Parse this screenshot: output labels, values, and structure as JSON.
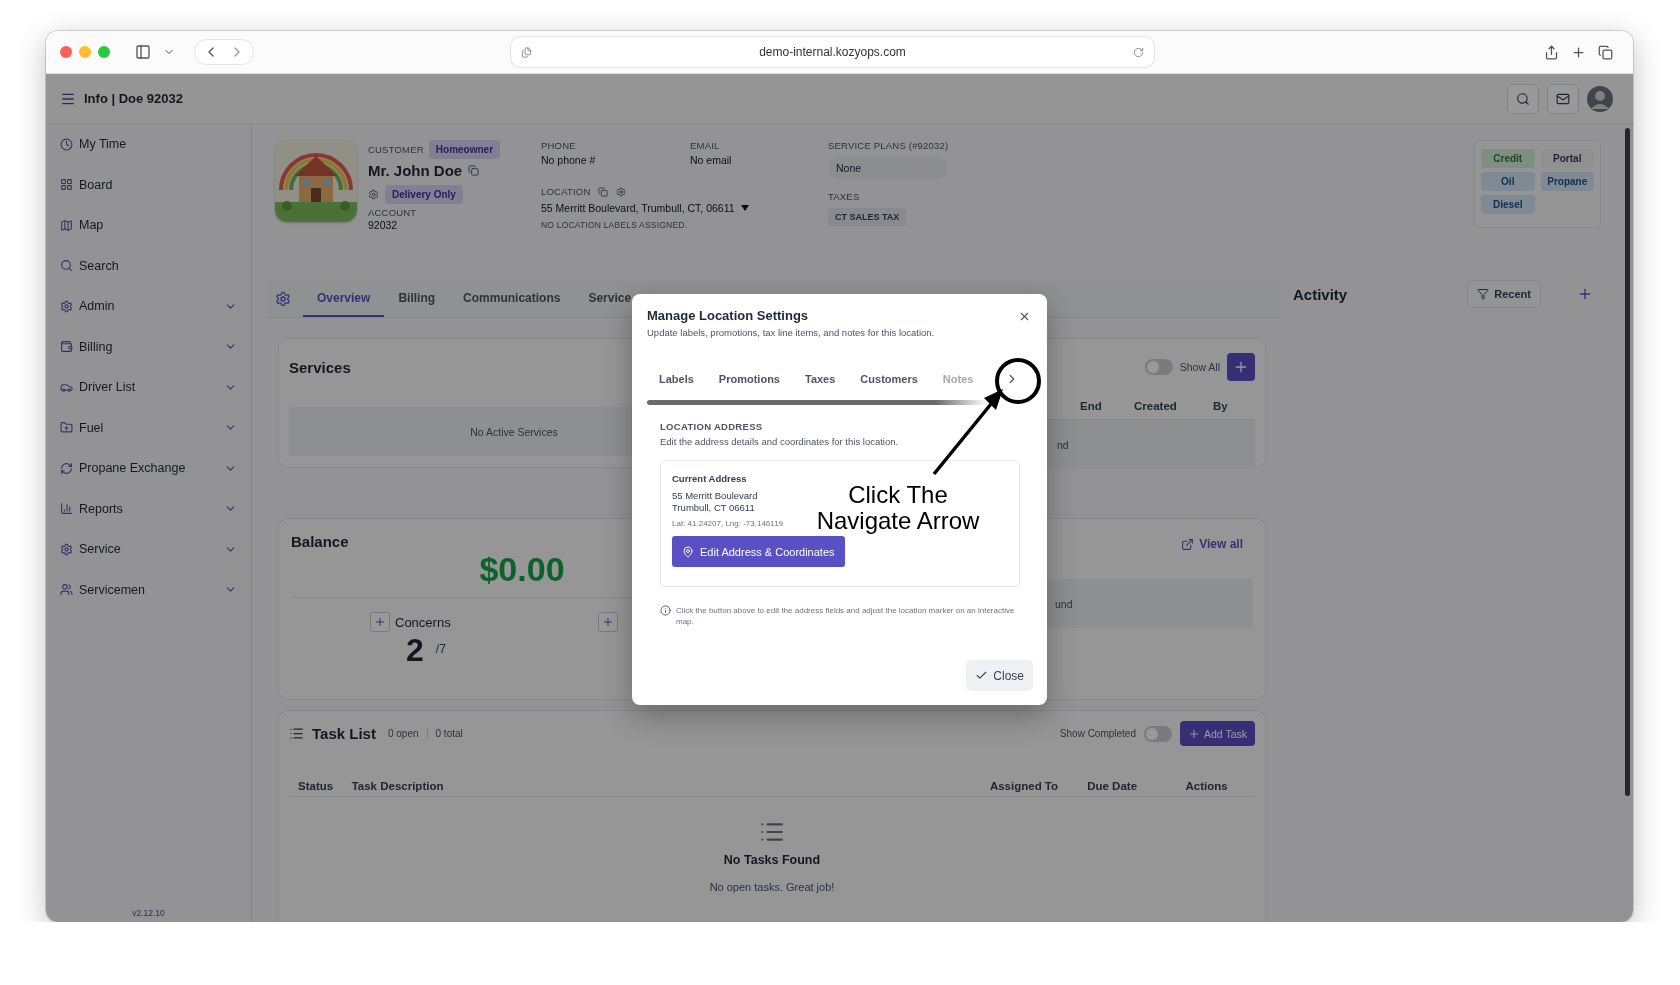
{
  "browser": {
    "url": "demo-internal.kozyops.com"
  },
  "header": {
    "title": "Info | Doe 92032"
  },
  "sidebar": {
    "items": [
      {
        "label": "My Time",
        "expandable": false
      },
      {
        "label": "Board",
        "expandable": false
      },
      {
        "label": "Map",
        "expandable": false
      },
      {
        "label": "Search",
        "expandable": false
      },
      {
        "label": "Admin",
        "expandable": true
      },
      {
        "label": "Billing",
        "expandable": true
      },
      {
        "label": "Driver List",
        "expandable": true
      },
      {
        "label": "Fuel",
        "expandable": true
      },
      {
        "label": "Propane Exchange",
        "expandable": true
      },
      {
        "label": "Reports",
        "expandable": true
      },
      {
        "label": "Service",
        "expandable": true
      },
      {
        "label": "Servicemen",
        "expandable": true
      }
    ],
    "version": "v2.12.10"
  },
  "customer": {
    "type_label": "CUSTOMER",
    "type_badge": "Homeowner",
    "name": "Mr. John Doe",
    "delivery_badge": "Delivery Only",
    "account_label": "ACCOUNT",
    "account": "92032"
  },
  "contact": [
    {
      "label": "PHONE",
      "value": "No phone #"
    },
    {
      "label": "EMAIL",
      "value": "No email"
    }
  ],
  "location": {
    "label": "LOCATION",
    "address": "55 Merritt Boulevard, Trumbull, CT, 06611",
    "note": "NO LOCATION LABELS ASSIGNED."
  },
  "service_plans": {
    "label": "SERVICE PLANS (#92032)",
    "value": "None"
  },
  "taxes": {
    "label": "TAXES",
    "badges": [
      "CT SALES TAX"
    ]
  },
  "fuel_tags": [
    {
      "label": "Credit",
      "kind": "status"
    },
    {
      "label": "Portal",
      "kind": "plain"
    },
    {
      "label": "Oil",
      "kind": "fuel"
    },
    {
      "label": "Propane",
      "kind": "fuel"
    },
    {
      "label": "Diesel",
      "kind": "fuel"
    }
  ],
  "tabs": [
    {
      "label": "Overview",
      "selected": true
    },
    {
      "label": "Billing",
      "selected": false
    },
    {
      "label": "Communications",
      "selected": false
    },
    {
      "label": "Service",
      "selected": false
    }
  ],
  "services": {
    "title": "Services",
    "empty": "No Active Services",
    "toggle": {
      "label": "Show All",
      "on": false
    },
    "columns": [
      "End",
      "Created",
      "By"
    ],
    "row_fragment": "nd"
  },
  "balance": {
    "title": "Balance",
    "amount": "$0.00",
    "stats": [
      {
        "label": "Concerns",
        "value": "2",
        "total": "/7"
      }
    ],
    "link": "View all",
    "row_fragment": "und"
  },
  "task_list": {
    "title": "Task List",
    "counts": [
      "0 open",
      "0 total"
    ],
    "toggle": {
      "label": "Show Completed",
      "on": false
    },
    "add_button": "Add Task",
    "columns": [
      "Status",
      "Task Description",
      "Assigned To",
      "Due Date",
      "Actions"
    ],
    "empty_title": "No Tasks Found",
    "empty_text": "No open tasks. Great job!"
  },
  "activity": {
    "title": "Activity",
    "filter": "Recent"
  },
  "modal": {
    "title": "Manage Location Settings",
    "subtitle": "Update labels, promotions, tax line items, and notes for this location.",
    "tabs": [
      {
        "label": "Labels",
        "faded": false
      },
      {
        "label": "Promotions",
        "faded": false
      },
      {
        "label": "Taxes",
        "faded": false
      },
      {
        "label": "Customers",
        "faded": false
      },
      {
        "label": "Notes",
        "faded": true
      }
    ],
    "section_title": "LOCATION ADDRESS",
    "section_text": "Edit the address details and coordinates for this location.",
    "address_card": {
      "title": "Current Address",
      "lines": [
        "55 Merritt Boulevard",
        "Trumbull, CT 06611"
      ],
      "coords": "Lat: 41.24207, Lng: -73.146119",
      "button": "Edit Address & Coordinates"
    },
    "info": "Click the button above to edit the address fields and adjust the location marker on an interactive map.",
    "close_button": "Close"
  },
  "annotation": {
    "text": "Click The Navigate Arrow"
  }
}
